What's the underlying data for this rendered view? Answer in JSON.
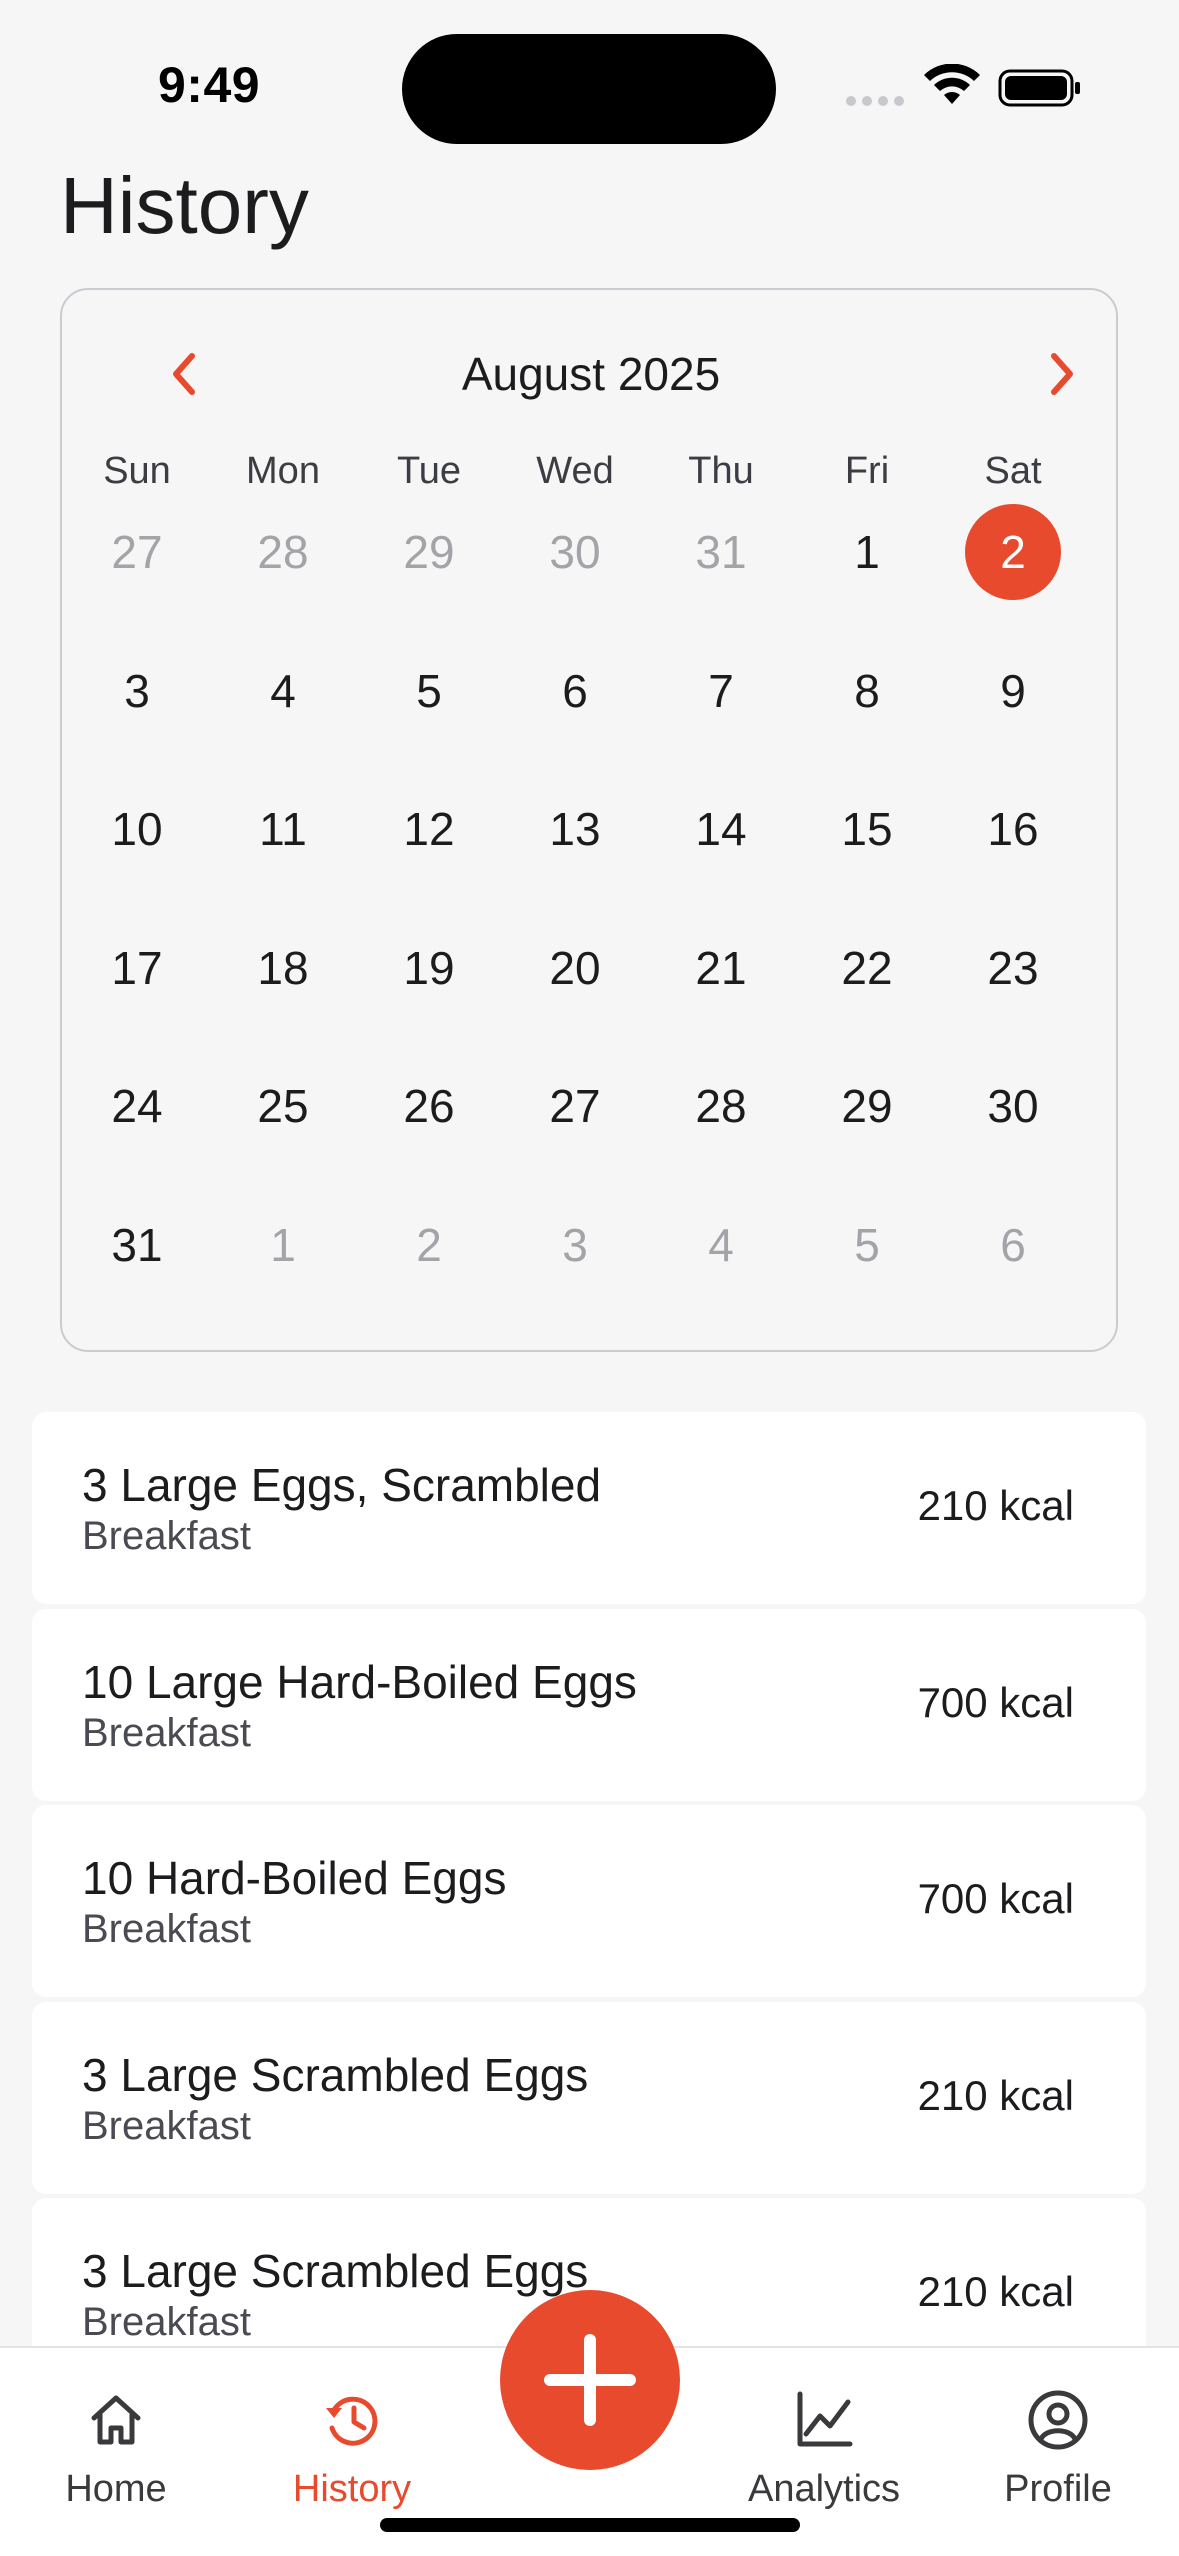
{
  "status_bar": {
    "time": "9:49"
  },
  "page": {
    "title": "History"
  },
  "calendar": {
    "month_label": "August 2025",
    "weekdays": [
      "Sun",
      "Mon",
      "Tue",
      "Wed",
      "Thu",
      "Fri",
      "Sat"
    ],
    "selected_day": "2",
    "weeks": [
      [
        {
          "d": "27",
          "muted": true
        },
        {
          "d": "28",
          "muted": true
        },
        {
          "d": "29",
          "muted": true
        },
        {
          "d": "30",
          "muted": true
        },
        {
          "d": "31",
          "muted": true
        },
        {
          "d": "1",
          "muted": false
        },
        {
          "d": "2",
          "muted": false,
          "selected": true
        }
      ],
      [
        {
          "d": "3"
        },
        {
          "d": "4"
        },
        {
          "d": "5"
        },
        {
          "d": "6"
        },
        {
          "d": "7"
        },
        {
          "d": "8"
        },
        {
          "d": "9"
        }
      ],
      [
        {
          "d": "10"
        },
        {
          "d": "11"
        },
        {
          "d": "12"
        },
        {
          "d": "13"
        },
        {
          "d": "14"
        },
        {
          "d": "15"
        },
        {
          "d": "16"
        }
      ],
      [
        {
          "d": "17"
        },
        {
          "d": "18"
        },
        {
          "d": "19"
        },
        {
          "d": "20"
        },
        {
          "d": "21"
        },
        {
          "d": "22"
        },
        {
          "d": "23"
        }
      ],
      [
        {
          "d": "24"
        },
        {
          "d": "25"
        },
        {
          "d": "26"
        },
        {
          "d": "27"
        },
        {
          "d": "28"
        },
        {
          "d": "29"
        },
        {
          "d": "30"
        }
      ],
      [
        {
          "d": "31"
        },
        {
          "d": "1",
          "muted": true
        },
        {
          "d": "2",
          "muted": true
        },
        {
          "d": "3",
          "muted": true
        },
        {
          "d": "4",
          "muted": true
        },
        {
          "d": "5",
          "muted": true
        },
        {
          "d": "6",
          "muted": true
        }
      ]
    ],
    "nav_icons": {
      "prev": "chevron-left-icon",
      "next": "chevron-right-icon"
    }
  },
  "meals": [
    {
      "name": "3 Large Eggs, Scrambled",
      "type": "Breakfast",
      "kcal": "210 kcal"
    },
    {
      "name": "10 Large Hard-Boiled Eggs",
      "type": "Breakfast",
      "kcal": "700 kcal"
    },
    {
      "name": "10 Hard-Boiled Eggs",
      "type": "Breakfast",
      "kcal": "700 kcal"
    },
    {
      "name": "3 Large Scrambled Eggs",
      "type": "Breakfast",
      "kcal": "210 kcal"
    },
    {
      "name": "3 Large Scrambled Eggs",
      "type": "Breakfast",
      "kcal": "210 kcal"
    }
  ],
  "tab_bar": {
    "home": {
      "label": "Home",
      "icon": "home-icon"
    },
    "history": {
      "label": "History",
      "icon": "history-icon",
      "active": true
    },
    "add": {
      "icon": "plus-icon"
    },
    "analytics": {
      "label": "Analytics",
      "icon": "chart-icon"
    },
    "profile": {
      "label": "Profile",
      "icon": "profile-icon"
    }
  },
  "colors": {
    "accent": "#e84a2e",
    "background": "#f6f6f6",
    "card": "#ffffff",
    "muted_text": "#a3a3a8"
  }
}
